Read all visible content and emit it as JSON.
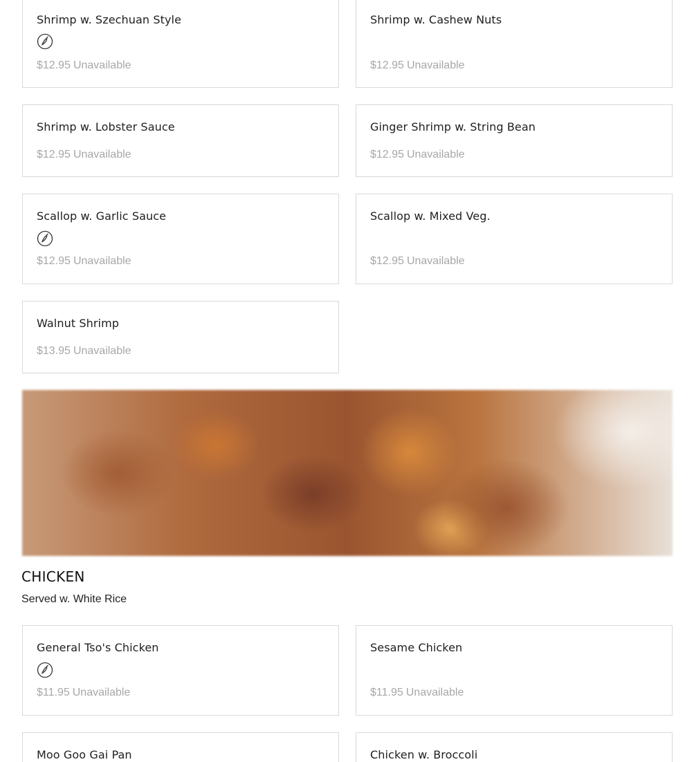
{
  "items": [
    {
      "name": "Shrimp w. Szechuan Style",
      "spicy": true,
      "price": "$12.95",
      "status": "Unavailable"
    },
    {
      "name": "Shrimp w. Cashew Nuts",
      "spicy": false,
      "price": "$12.95",
      "status": "Unavailable"
    },
    {
      "name": "Shrimp w. Lobster Sauce",
      "spicy": false,
      "price": "$12.95",
      "status": "Unavailable"
    },
    {
      "name": "Ginger Shrimp w. String Bean",
      "spicy": false,
      "price": "$12.95",
      "status": "Unavailable"
    },
    {
      "name": "Scallop w. Garlic Sauce",
      "spicy": true,
      "price": "$12.95",
      "status": "Unavailable"
    },
    {
      "name": "Scallop w. Mixed Veg.",
      "spicy": false,
      "price": "$12.95",
      "status": "Unavailable"
    },
    {
      "name": "Walnut Shrimp",
      "spicy": false,
      "price": "$13.95",
      "status": "Unavailable"
    }
  ],
  "chicken": {
    "title": "CHICKEN",
    "subtitle": "Served w. White Rice",
    "items": [
      {
        "name": "General Tso's Chicken",
        "spicy": true,
        "price": "$11.95",
        "status": "Unavailable"
      },
      {
        "name": "Sesame Chicken",
        "spicy": false,
        "price": "$11.95",
        "status": "Unavailable"
      },
      {
        "name": "Moo Goo Gai Pan",
        "spicy": false,
        "price": "",
        "status": ""
      },
      {
        "name": "Chicken w. Broccoli",
        "spicy": false,
        "price": "",
        "status": ""
      }
    ]
  },
  "icons": {
    "spicy": "chili-pepper-icon"
  },
  "colors": {
    "price_text": "#a7a7a7",
    "card_border": "#d9d9d9"
  }
}
